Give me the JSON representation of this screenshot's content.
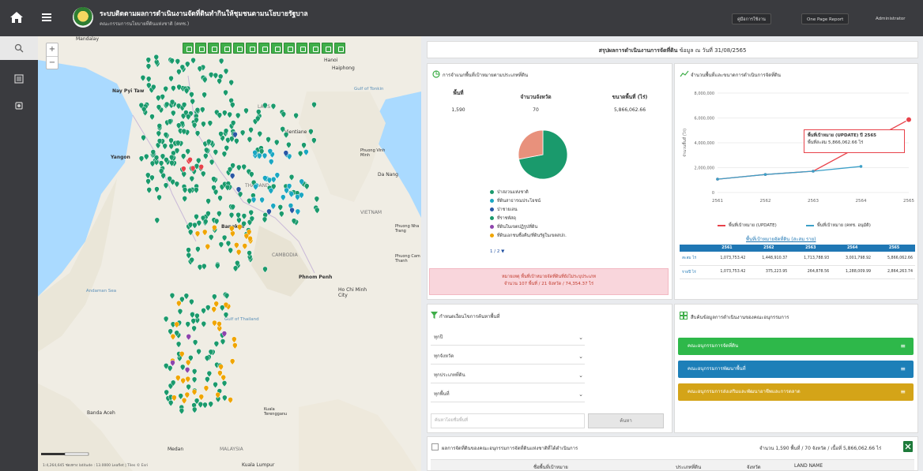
{
  "header": {
    "title": "ระบบติดตามผลการดำเนินงานจัดที่ดินทำกินให้ชุมชนตามนโยบายรัฐบาล",
    "subtitle": "คณะกรรมการนโยบายที่ดินแห่งชาติ (คทช.)",
    "buttons": [
      "คู่มือการใช้งาน",
      "One Page Report"
    ],
    "user": "Administrator"
  },
  "map": {
    "labels": [
      "Mandalay",
      "Hanoi",
      "Haiphong",
      "Nay Pyi Taw",
      "LAOS",
      "Vientiane",
      "Yangon",
      "Phuong Vinh Minh",
      "Da Nang",
      "THAILAND",
      "VIETNAM",
      "Bangkok",
      "CAMBODIA",
      "Phnom Penh",
      "Ho Chi Minh City",
      "Phuong Nha Trang",
      "Phuong Cam Thanh",
      "Banda Aceh",
      "Medan",
      "MALAYSIA",
      "Kuala Terengganu",
      "Kuala Lumpur"
    ],
    "seas": [
      "Gulf of Tonkin",
      "Andaman Sea",
      "Gulf of Thailand"
    ],
    "scale_text": "1:4,264,645  ช่องทาง latitude : 13.0000  Leaflet | Tiles © Esri"
  },
  "summary": {
    "title": "สรุปผลการดำเนินงานการจัดที่ดิน",
    "date": "ข้อมูล ณ วันที่ 31/08/2565"
  },
  "donut_panel": {
    "title": "การจำแนกพื้นที่เป้าหมายตามประเภทที่ดิน",
    "stats": [
      {
        "label": "พื้นที่",
        "value": "1,590"
      },
      {
        "label": "จำนวนจังหวัด",
        "value": "70"
      },
      {
        "label": "ขนาดพื้นที่ (ไร่)",
        "value": "5,866,062.66"
      }
    ],
    "legend": [
      {
        "label": "ป่าสงวนแห่งชาติ",
        "color": "#1a9a6c"
      },
      {
        "label": "ที่ดินสาธารณประโยชน์",
        "color": "#1aa7c2"
      },
      {
        "label": "ป่าชายเลน",
        "color": "#2a57a5"
      },
      {
        "label": "ที่ราชพัสดุ",
        "color": "#1a9a6c"
      },
      {
        "label": "ที่ดินในเขตปฏิรูปที่ดิน",
        "color": "#8e44ad"
      },
      {
        "label": "ที่ดินเอกชนซื้อคืน/ที่ดินรัฐในเขตสปก.",
        "color": "#f0a500"
      }
    ],
    "pager": "1 / 2",
    "alert_line1": "หมายเหตุ พื้นที่เป้าหมายจัดที่ดินที่ยังไม่ระบุประเภท",
    "alert_line2": "จำนวน 107 พื้นที่ / 21 จังหวัด / 74,354.37 ไร่"
  },
  "line_panel": {
    "title": "จำนวนพื้นที่และขนาดการดำเนินการจัดที่ดิน",
    "tooltip_line1": "พื้นที่เป้าหมาย (UPDATE) ปี 2565",
    "tooltip_line2": "พื้นที่สะสม 5,866,062.66 ไร่",
    "legend": [
      "พื้นที่เป้าหมาย (UPDATE)",
      "พื้นที่เป้าหมาย (คทช. อนุมัติ)"
    ],
    "table_title": "พื้นที่เป้าหมายจัดที่ดิน (สะสม ราย)",
    "table_headers": [
      "",
      "2561",
      "2562",
      "2563",
      "2564",
      "2565"
    ],
    "table_rows": [
      {
        "label": "สะสม ไร่",
        "values": [
          "1,073,753.42",
          "1,448,910.37",
          "1,713,788.93",
          "3,001,798.92",
          "5,866,062.66"
        ]
      },
      {
        "label": "รายปี ไร่",
        "values": [
          "1,073,753.42",
          "375,223.95",
          "264,878.56",
          "1,288,009.99",
          "2,864,263.74"
        ]
      }
    ]
  },
  "chart_data": {
    "type": "line",
    "x": [
      "2561",
      "2562",
      "2563",
      "2564",
      "2565"
    ],
    "y_ticks": [
      "0",
      "2,000,000",
      "4,000,000",
      "6,000,000",
      "8,000,000"
    ],
    "ylim": [
      0,
      8000000
    ],
    "ylabel": "จำนวนพื้นที่ (ไร่)",
    "series": [
      {
        "name": "พื้นที่เป้าหมาย (UPDATE)",
        "color": "#e8424a",
        "values": [
          1073753.42,
          1448910.37,
          1713788.93,
          null,
          5866062.66
        ]
      },
      {
        "name": "พื้นที่เป้าหมาย (คทช. อนุมัติ)",
        "color": "#3ca0c8",
        "values": [
          1073753.42,
          1448910.37,
          1713788.93,
          2100000,
          null
        ]
      }
    ],
    "legend_position": "bottom"
  },
  "donut_data": {
    "type": "pie",
    "slices": [
      {
        "label": "ป่าสงวนแห่งชาติ",
        "value": 72,
        "color": "#1a9a6c"
      },
      {
        "label": "ที่ดินสาธารณประโยชน์",
        "value": 28,
        "color": "#e8917c"
      }
    ]
  },
  "filter_panel": {
    "title": "กำหนดเงื่อนไขการค้นหาพื้นที่",
    "selects": [
      "ทุกปี",
      "ทุกจังหวัด",
      "ทุกประเภทที่ดิน",
      "ทุกพื้นที่"
    ],
    "search_placeholder": "ค้นหาโดยชื่อพื้นที่",
    "search_button": "ค้นหา"
  },
  "links_panel": {
    "title": "สืบค้นข้อมูลการดำเนินงานของคณะอนุกรรมการ",
    "links": [
      {
        "label": "คณะอนุกรรมการจัดที่ดิน",
        "color": "#2eb84a"
      },
      {
        "label": "คณะอนุกรรมการพัฒนาพื้นที่",
        "color": "#1d7fb8"
      },
      {
        "label": "คณะอนุกรรมการส่งเสริมและพัฒนาอาชีพและการตลาด",
        "color": "#d4a418"
      }
    ]
  },
  "bottom_panel": {
    "title": "ผลการจัดที่ดินของคณะอนุกรรมการจัดที่ดินแห่งชาติที่ได้ดำเนินการ",
    "stats": "จำนวน 1,590 พื้นที่ / 70 จังหวัด / เนื้อที่ 5,866,062.66 ไร่",
    "columns": [
      "ชื่อพื้นที่เป้าหมาย",
      "ประเภทที่ดิน",
      "จังหวัด",
      "LAND NAME"
    ]
  }
}
